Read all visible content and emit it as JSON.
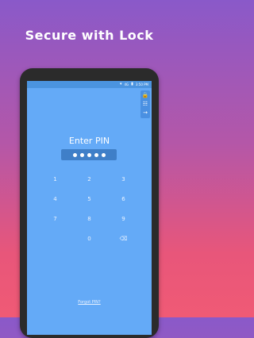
{
  "headline": "Secure with Lock",
  "status_bar": {
    "signal_icon": "wifi-icon",
    "network": "4G",
    "battery_icon": "battery-icon",
    "time": "3:50 PM"
  },
  "side_tools": [
    {
      "icon": "lock-icon",
      "glyph": "🔒"
    },
    {
      "icon": "grid-icon",
      "glyph": "☷"
    },
    {
      "icon": "arrow-right-icon",
      "glyph": "→"
    }
  ],
  "lock_screen": {
    "prompt": "Enter PIN",
    "pin_length": 5,
    "keys": [
      "1",
      "2",
      "3",
      "4",
      "5",
      "6",
      "7",
      "8",
      "9",
      "",
      "0",
      "⌫"
    ],
    "forgot_link": "Forgot PIN?"
  },
  "colors": {
    "background_top": "#8a59c9",
    "background_bottom": "#f05a75",
    "screen": "#64aaf7",
    "pin_box": "#3f7fc8"
  }
}
